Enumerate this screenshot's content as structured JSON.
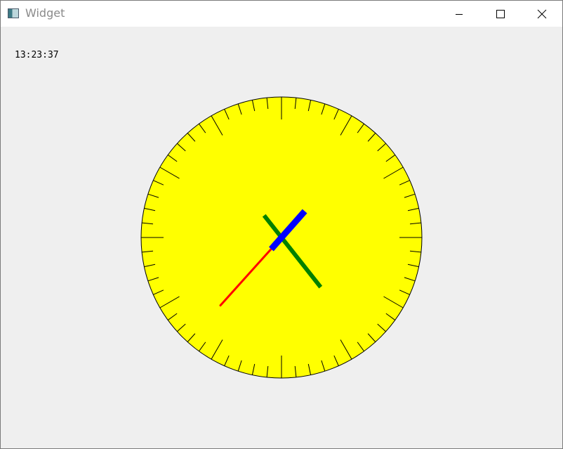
{
  "window": {
    "title": "Widget",
    "icon": "app-window-icon",
    "controls": [
      "minimize-icon",
      "maximize-icon",
      "close-icon"
    ]
  },
  "clock": {
    "time_text": "13:23:37",
    "hours": 13,
    "minutes": 23,
    "seconds": 37,
    "tick_count": 60,
    "colors": {
      "face": "#ffff00",
      "outline": "#000000",
      "ticks": "#000000",
      "hour_hand": "#0000ff",
      "minute_hand": "#008000",
      "second_hand": "#ff0000",
      "background": "#efefef"
    }
  }
}
